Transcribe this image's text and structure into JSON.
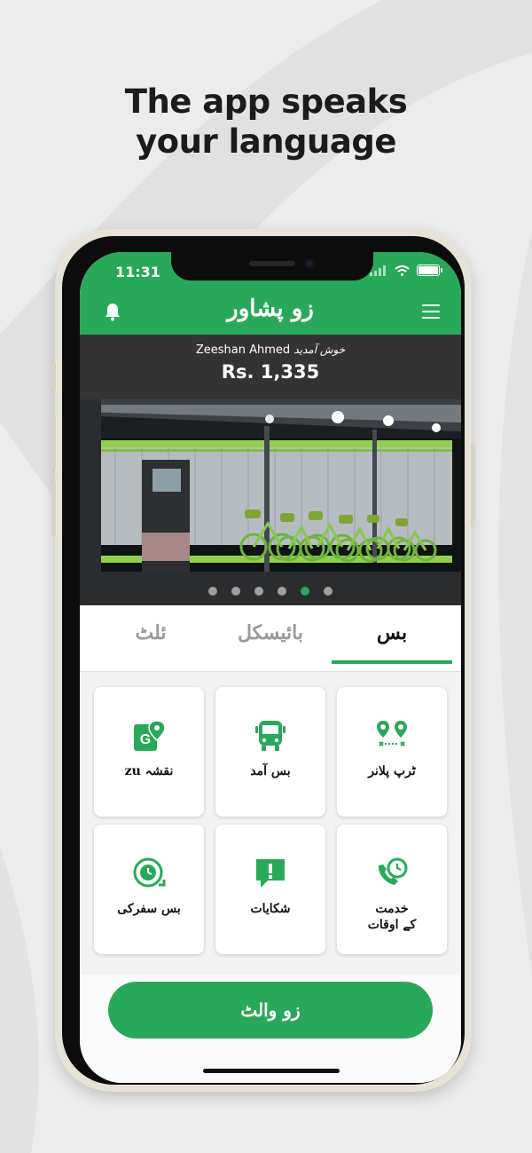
{
  "headline": {
    "line1": "The app speaks",
    "line2": "your language"
  },
  "status_bar": {
    "time": "11:31"
  },
  "header": {
    "title": "زو پشاور",
    "bell_icon": "bell-icon",
    "menu_icon": "hamburger-menu-icon"
  },
  "account": {
    "greeting_urdu": "خوش آمدید",
    "user_name": "Zeeshan Ahmed",
    "balance": "Rs. 1,335"
  },
  "carousel": {
    "slides": 6,
    "active_index": 4
  },
  "tabs": [
    {
      "label": "ئلٹ",
      "active": false
    },
    {
      "label": "بائیسکل",
      "active": false
    },
    {
      "label": "بس",
      "active": true
    }
  ],
  "tiles": [
    {
      "label": "zu نقشہ",
      "icon": "map-pin-icon"
    },
    {
      "label": "بس آمد",
      "icon": "bus-icon"
    },
    {
      "label": "ٹرپ پلانر",
      "icon": "trip-route-icon"
    },
    {
      "label": "بس سفرکی",
      "icon": "clock-history-icon"
    },
    {
      "label": "شکایات",
      "icon": "alert-message-icon"
    },
    {
      "label_line1": "خدمت",
      "label_line2": "کے اوقات",
      "icon": "service-hours-icon"
    }
  ],
  "wallet_button": {
    "label": "زو والٹ"
  },
  "colors": {
    "brand_green": "#2aa85a",
    "dark_bar": "#333333"
  }
}
